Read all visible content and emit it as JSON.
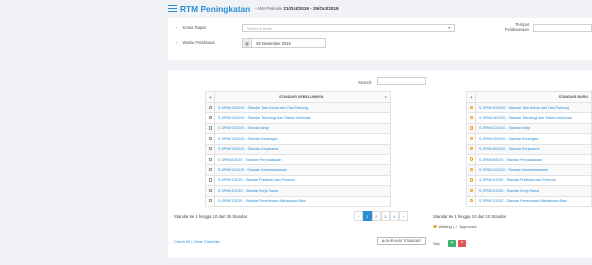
{
  "header": {
    "title": "RTM Peningkatan",
    "subtitle_prefix": "- AMI Periode",
    "period": "21/Oct/2019 - 25/Oct/2019",
    "icon": "list-icon",
    "accent_color": "#2a8dd4"
  },
  "form": {
    "ketua_label": "Ketua Rapat",
    "ketua_placeholder": "Select a State",
    "waktu_label": "Waktu Pelaksaan",
    "waktu_value": "29 November 2019",
    "tempat_label": "Tempat Pelaksanaan",
    "tempat_value": ""
  },
  "search": {
    "label": "Search:",
    "value": ""
  },
  "left_table": {
    "header": "STANDAR SEBELUMNYA",
    "rows": [
      "S-SPMI/10/2019 - Standar Tata Kelola dan Tata Pamong",
      "S-SPMI/14/2019 - Standar Teknologi dan Sistem Informasi",
      "S-SPMI/12/2019 - Standar Arsip",
      "S-SPMI/13/2019 - Standar Keuangan",
      "S-SPMI/15/2019 - Standar Kerjasama",
      "S-SPMI/8/2019 - Standar Perpustakaan",
      "S-SPMI/11/2019 - Standar Kemahasiswaan",
      "S-SPMI/1/2019 - Standar Publikasi dan Promosi",
      "S-SPMI/3/2019 - Standar Kerja Sama",
      "S-SPMI/7/2019 - Standar Penerimaan Mahasiswa Baru"
    ],
    "info": "Standar ke 1 hingga 10 dari 35 Standar"
  },
  "right_table": {
    "header": "STANDAR BARU",
    "rows": [
      "S-SPMI/10/2020 - Standar Tata Kelola dan Tata Pamong",
      "S-SPMI/14/2020 - Standar Teknologi dan Sistem Informasi",
      "S-SPMI/12/2020 - Standar Arsip",
      "S-SPMI/13/2020 - Standar Keuangan",
      "S-SPMI/15/2020 - Standar Kerjasama",
      "S-SPMI/8/2020 - Standar Perpustakaan",
      "S-SPMI/11/2020 - Standar Kemahasiswaan",
      "S-SPMI/1/2020 - Standar Publikasi dan Promosi",
      "S-SPMI/3/2020 - Standar Kerja Sama",
      "S-SPMI/7/2020 - Standar Penerimaan Mahasiswa Baru"
    ],
    "info": "Standar ke 1 hingga 10 dari 10 Standar",
    "legend": "Waiting | ✓ Approved"
  },
  "pagination": {
    "prev": "‹",
    "pages": [
      "1",
      "2",
      "3",
      "4"
    ],
    "next": "›",
    "active": "1"
  },
  "actions": {
    "check_all": "Check All",
    "clear_checklist": "Clear Checklist",
    "separator": "|",
    "duplicate": "DUPLIKAT STANDAR",
    "skip_label": "Skip",
    "approve_icon": "+",
    "reject_icon": "×"
  }
}
